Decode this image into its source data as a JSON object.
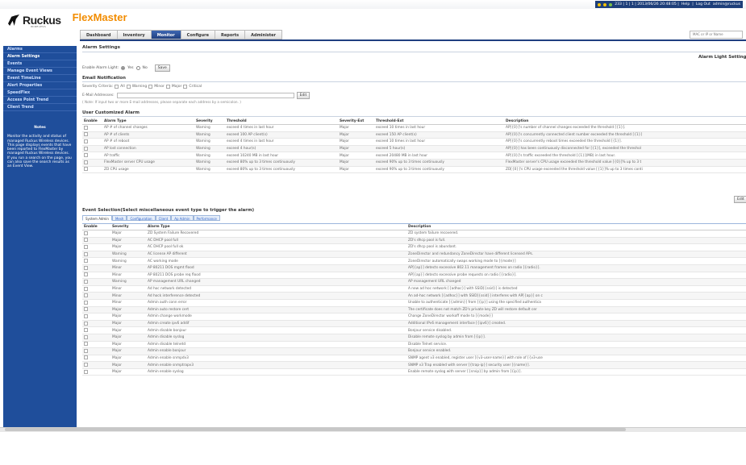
{
  "topbar": {
    "status": "233 | 1 | 1 | 2013/06/26 20:48:05 |",
    "help": "Help",
    "logout": "Log Out",
    "user": "admin@ruckus"
  },
  "brand": {
    "company": "Ruckus",
    "wireless": "WIRELESS",
    "product": "FlexMaster"
  },
  "tabs": [
    "Dashboard",
    "Inventory",
    "Monitor",
    "Configure",
    "Reports",
    "Administer"
  ],
  "active_tab": "Monitor",
  "search": {
    "placeholder": "MAC or IP or Name"
  },
  "sidebar": {
    "items": [
      "Alarms",
      "Alarm Settings",
      "Events",
      "Manage Event Views",
      "Event TimeLine",
      "Alert Properties",
      "SpeedFlex",
      "Access Point Trend",
      "Client Trend"
    ],
    "active": "Alarm Settings"
  },
  "notes": {
    "title": "Notes",
    "text": "Monitor the activity and status of managed Ruckus Wireless devices. This page displays events that have been reported to FlexMaster by managed Ruckus Wireless devices. If you run a search on the page, you can also save the search results as an Event View."
  },
  "page": {
    "title": "Alarm Settings",
    "alarm_light_title": "Alarm Light Settings",
    "enable_alarm_light": "Enable Alarm Light:",
    "yes": "Yes",
    "no": "No",
    "save": "Save"
  },
  "email": {
    "title": "Email Notification",
    "criteria_label": "Severity Criteria:",
    "criteria": [
      "All",
      "Warning",
      "Minor",
      "Major",
      "Critical"
    ],
    "addresses_label": "E-Mail Addresses:",
    "edit": "Edit",
    "note": "( Note: If input two or more E-mail addresses, please separate each address by a semicolon. )"
  },
  "user_alarm": {
    "title": "User Customized Alarm",
    "columns": [
      "Enable",
      "Alarm Type",
      "Severity",
      "Threshold",
      "Severity-Ext",
      "Threshold-Ext",
      "Description"
    ],
    "rows": [
      [
        "AP # of channel changes",
        "Warning",
        "exceed 4 times in last hour",
        "Major",
        "exceed 10 times in last hour",
        "AP[{0}]'s number of channel changes exceeded the threshold [{1}]."
      ],
      [
        "AP # of clients",
        "Warning",
        "exceed 100 AP client(s)",
        "Major",
        "exceed 150 AP client(s)",
        "AP[{0}]'s concurrently connected client number exceeded the threshold [{1}]"
      ],
      [
        "AP # of reboot",
        "Warning",
        "exceed 4 times in last hour",
        "Major",
        "exceed 10 times in last hour",
        "AP[{0}]'s concurrently reboot times exceeded the threshold [{1}]."
      ],
      [
        "AP lost connection",
        "Warning",
        "exceed 4 hour(s)",
        "Major",
        "exceed 5 hour(s)",
        "AP[{0}] has been continuously disconnected for [{1}], exceeded the threshol"
      ],
      [
        "AP traffic",
        "Warning",
        "exceed 10240 MB in last hour",
        "Major",
        "exceed 20480 MB in last hour",
        "AP[{0}]'s traffic exceeded the threshold [{1}](MB) in last hour."
      ],
      [
        "FlexMaster server CPU usage",
        "Warning",
        "exceed 80% up to 3 times continuously",
        "Major",
        "exceed 90% up to 3 times continuously",
        "FlexMaster server's CPU usage exceeded the threshold value [{0}]% up to 3 t"
      ],
      [
        "ZD CPU usage",
        "Warning",
        "exceed 80% up to 3 times continuously",
        "Major",
        "exceed 90% up to 3 times continuously",
        "ZD[{0}]'s CPU usage exceeded the threshold value [{1}]% up to 3 times conti"
      ]
    ],
    "edit": "Edit"
  },
  "events": {
    "title": "Event Selection(Select miscellaneous event type to trigger the alarm)",
    "tabs": [
      "System Admin",
      "Mesh",
      "Configuration",
      "Client",
      "Ap Admin",
      "Performance"
    ],
    "columns": [
      "Enable",
      "Severity",
      "Alarm Type",
      "Description"
    ],
    "rows": [
      [
        "Major",
        "ZD System Failure Recovered",
        "ZD system failure recovered."
      ],
      [
        "Major",
        "AC DHCP pool full",
        "ZD's dhcp pool is full."
      ],
      [
        "Major",
        "AC DHCP pool full ok",
        "ZD's dhcp pool is abundant."
      ],
      [
        "Warning",
        "AC license AP different",
        "ZoneDirector and redundancy ZoneDirector have different licensed APs."
      ],
      [
        "Warning",
        "AC working mode",
        "ZoneDirector automatically swaps working mode to [{mode}]"
      ],
      [
        "Minor",
        "AP 80211 DOS mgmt flood",
        "AP[{ap}] detects excessive 802.11 management frames on radio [{radio}]."
      ],
      [
        "Minor",
        "AP 80211 DOS probe req flood",
        "AP[{ap}] detects excessive probe requests on radio [{radio}]."
      ],
      [
        "Warning",
        "AP management URL changed",
        "AP management URL changed"
      ],
      [
        "Minor",
        "Ad hoc network detected",
        "A new ad hoc network [{adhoc}] with SSID[{ssid}] is detected"
      ],
      [
        "Minor",
        "Ad hock interference detected",
        "An ad-hoc network [{adhoc}] with SSID[{ssid}] interferes with AP[{ap}] on c"
      ],
      [
        "Minor",
        "Admin auth conn error",
        "Unable to authenticate [{admin}] from [{ip}] using the specified authentica"
      ],
      [
        "Major",
        "Admin auto restore cert",
        "The certificate does not match ZD's private key ZD will restore default cer"
      ],
      [
        "Major",
        "Admin change workmode",
        "Change ZoneDirector workoff mode to [{mode}]"
      ],
      [
        "Major",
        "Admin create ipv6 addif",
        "Additional IPv6 management interface [{ipv6}] created."
      ],
      [
        "Major",
        "Admin disable bonjour",
        "Bonjour service disabled."
      ],
      [
        "Major",
        "Admin disable syslog",
        "Disable remote syslog by admin from [{ip}]."
      ],
      [
        "Major",
        "Admin disable telnetd",
        "Disable Telnet service."
      ],
      [
        "Major",
        "Admin enable bonjour",
        "Bonjour service enabled."
      ],
      [
        "Major",
        "Admin enable snmpdv3",
        "SNMP agent v3 enabled, register user [{v3-user-name}] with role of [{v3-use"
      ],
      [
        "Major",
        "Admin enable snmptrapv3",
        "SNMP v3 Trap enabled with server [{trap-ip}] security user [{name}]."
      ],
      [
        "Major",
        "Admin enable syslog",
        "Enable remote syslog with server [{srvip}] by admin from [{ip}]."
      ]
    ]
  }
}
